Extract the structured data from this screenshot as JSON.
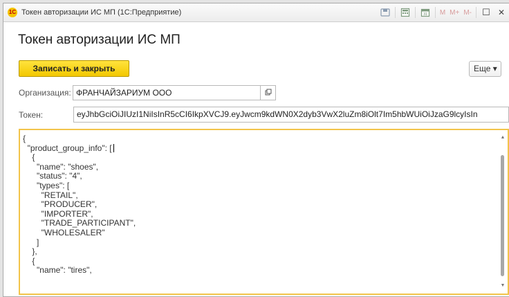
{
  "window": {
    "app_icon_text": "1С",
    "title": "Токен авторизации ИС МП  (1С:Предприятие)",
    "toolbar_icons": [
      "save-icon",
      "calculator-icon",
      "calendar-icon"
    ],
    "memory_buttons": [
      "M",
      "M+",
      "M-"
    ],
    "restore_glyph": "☐",
    "close_glyph": "✕"
  },
  "form": {
    "heading": "Токен авторизации ИС МП",
    "save_close_label": "Записать и закрыть",
    "more_label": "Еще ▾",
    "organization_label": "Организация:",
    "organization_value": "ФРАНЧАЙЗАРИУМ ООО",
    "token_label": "Токен:",
    "token_value": "eyJhbGciOiJIUzI1NiIsInR5cCI6IkpXVCJ9.eyJwcm9kdWN0X2dyb3VwX2luZm8iOlt7Im5hbWUiOiJzaG9lcyIsIn"
  },
  "editor": {
    "lines": [
      "{",
      "  \"product_group_info\": [",
      "    {",
      "      \"name\": \"shoes\",",
      "      \"status\": \"4\",",
      "      \"types\": [",
      "        \"RETAIL\",",
      "        \"PRODUCER\",",
      "        \"IMPORTER\",",
      "        \"TRADE_PARTICIPANT\",",
      "        \"WHOLESALER\"",
      "      ]",
      "    },",
      "    {",
      "      \"name\": \"tires\","
    ]
  },
  "colors": {
    "accent_button": "#f3c800",
    "editor_focus_border": "#f2c44a"
  }
}
